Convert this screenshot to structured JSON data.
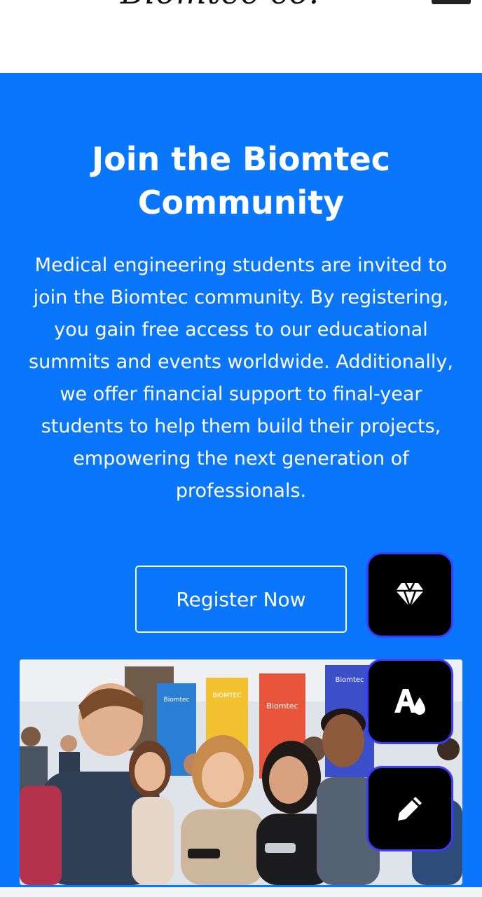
{
  "header": {
    "brand": "Biomtec co."
  },
  "hero": {
    "title": "Join the Biomtec Community",
    "description": "Medical engineering students are invited to join the Biomtec community. By registering, you gain free access to our educational summits and events worldwide. Additionally, we offer financial support to final-year students to help them build their projects, empowering the next generation of professionals.",
    "register_label": "Register Now",
    "background_color": "#0a76fc"
  },
  "photo": {
    "banners": [
      "Biomtec",
      "BIOMTEC",
      "Biomtec",
      "Biomtec"
    ]
  },
  "floating_tools": [
    {
      "icon": "diamond-icon"
    },
    {
      "icon": "text-color-icon"
    },
    {
      "icon": "pencil-icon"
    }
  ]
}
